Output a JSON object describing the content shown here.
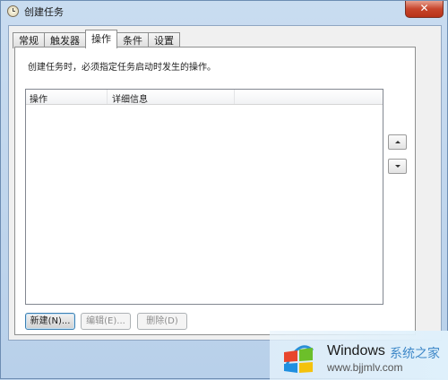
{
  "window": {
    "title": "创建任务",
    "close_glyph": "✕"
  },
  "tabs": [
    {
      "label": "常规"
    },
    {
      "label": "触发器"
    },
    {
      "label": "操作"
    },
    {
      "label": "条件"
    },
    {
      "label": "设置"
    }
  ],
  "active_tab": "操作",
  "description": "创建任务时，必须指定任务启动时发生的操作。",
  "list": {
    "columns": [
      "操作",
      "详细信息"
    ],
    "rows": []
  },
  "buttons": {
    "new": "新建(N)...",
    "edit": "编辑(E)...",
    "delete": "删除(D)"
  },
  "watermark": {
    "brand": "Windows",
    "cn": "系统之家",
    "url": "www.bjjmlv.com"
  },
  "colors": {
    "accent": "#3c7fb1",
    "close": "#c7452c"
  }
}
